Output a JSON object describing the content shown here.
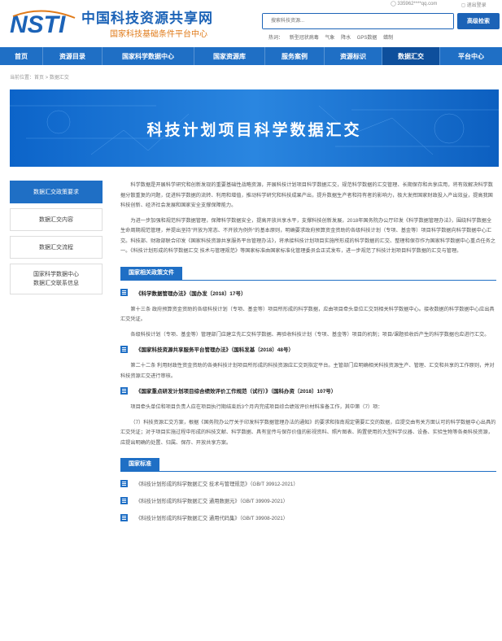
{
  "header": {
    "logo_text": "NSTI",
    "site_name": "中国科技资源共享网",
    "site_sub": "国家科技基础条件平台中心",
    "user": "335962****qq.com",
    "logout": "退出登录",
    "search_placeholder": "搜索科技资源...",
    "search_button": "高级检索",
    "hot_label": "热词：",
    "hot_words": [
      "新型冠状病毒",
      "气象",
      "降水",
      "GPS数据",
      "蜡制"
    ]
  },
  "nav": {
    "items": [
      "首页",
      "资源目录",
      "国家科学数据中心",
      "国家资源库",
      "服务案例",
      "资源标识",
      "数据汇交",
      "平台中心"
    ],
    "active": 6
  },
  "breadcrumb": "当前位置：首页 > 数据汇交",
  "banner_title": "科技计划项目科学数据汇交",
  "sidebar": {
    "items": [
      "数据汇交政策要求",
      "数据汇交内容",
      "数据汇交流程",
      "国家科学数据中心\n数据汇交联系信息"
    ]
  },
  "content": {
    "para1": "科学数据是开展科学研究和创新发现的重要基础性战略资源，开展科技计划项目科学数据汇交，规范科学数据的汇交管理、长期保存和共享应用，将有效解决科学数据分散重复的问题，促进科学数据的流转、利用和增值，推动科学研究和科技成果产出，提升数据生产者和持有者的影响力，极大发挥国家财政投入产出效益，提高我国科技创新、经济社会发展和国家安全支撑保障能力。",
    "para2": "为进一步加强和规范科学数据管理，保障科学数据安全，提高开放共享水平，支撑科技创新发展，2018年国务院办公厅印发《科学数据管理办法》，围绕科学数据全生命周期规范管理，并提出坚持\"开放为常态、不开放为例外\"的基本原则，明确要求政府预算资金资助的各级科技计划（专项、基金等）项目科学数据向科学数据中心汇交。科技部、财政部联合印发《国家科技资源共享服务平台管理办法》，将承接科技计划项目实施所形成的科学数据的汇交、整理和保存作为国家科学数据中心重点任务之一。《科技计划形成的科学数据汇交 技术与管理规范》等国家标准由国家标准化管理委员会正式发布，进一步规范了科技计划项目科学数据的汇交与管理。",
    "section1": "国家相关政策文件",
    "law1": "《科学数据管理办法》（国办发〔2018〕17号）",
    "law1_text1": "第十三条 政府预算资金资助的各级科技计划（专项、基金等）项目所形成的科学数据，应由项目牵头单位汇交到相关科学数据中心。接收数据的科学数据中心应出具汇交凭证。",
    "law1_text2": "各级科技计划（专项、基金等）管理部门应建立先汇交科学数据、再验收科技计划（专项、基金等）项目的机制；项目/课题验收后产生的科学数据也应进行汇交。",
    "law2": "《国家科技资源共享服务平台管理办法》（国科发基〔2018〕48号）",
    "law2_text": "第二十二条 利用财政性资金资助的各类科技计划项目所形成的科技资源应汇交到指定平台。主管部门应明确相关科技资源生产、管理、汇交和共享的工作原则，并对科技资源汇交进行审核。",
    "law3": "《国家重点研发计划项目综合绩效评价工作规范（试行）》（国科办资〔2018〕107号）",
    "law3_text1": "项目牵头单位和项目负责人应在项目执行期结束后3个月内完成项目综合绩效评价材料准备工作，其中第（7）项：",
    "law3_text2": "（7）科技资源汇交方案，根据《国务院办公厅关于印发科学数据管理办法的通知》的要求和指南规定需要汇交的数据，应提交由有关方面认可的科学数据中心出具的汇交凭证；对于项目实施过程中形成的科技文献、科学数据、具有宣传与保存价值的影视资料、照片图表、购置使用的大型科学仪器、设备、实验生物等各类科技资源，应提出明确的处置、归属、保存、开放共享方案。",
    "section2": "国家标准",
    "standards": [
      "《科技计划形成的科学数据汇交 技术与管理规范》（GB/T 39912-2021）",
      "《科技计划形成的科学数据汇交 通用数据元》（GB/T 39909-2021）",
      "《科技计划形成的科学数据汇交 通用代码集》（GB/T 39908-2021）"
    ]
  }
}
